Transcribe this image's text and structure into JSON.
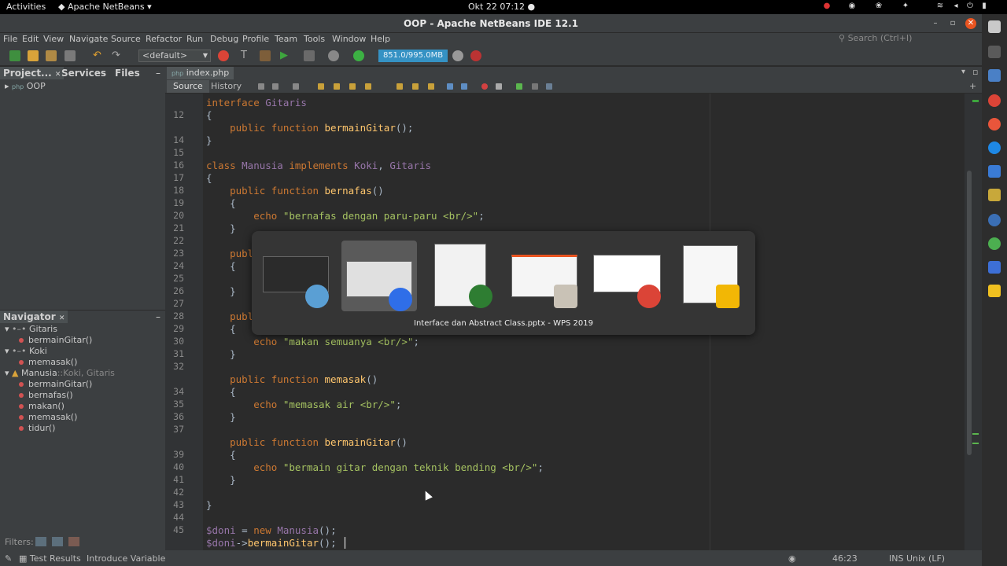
{
  "topbar": {
    "activities": "Activities",
    "app_menu": "Apache NetBeans",
    "clock": "Okt 22  07:12"
  },
  "window": {
    "title": "OOP - Apache NetBeans IDE 12.1"
  },
  "menu": [
    "File",
    "Edit",
    "View",
    "Navigate",
    "Source",
    "Refactor",
    "Run",
    "Debug",
    "Profile",
    "Team",
    "Tools",
    "Window",
    "Help"
  ],
  "search": {
    "placeholder": "Search (Ctrl+I)"
  },
  "toolbar": {
    "config": "<default>",
    "memory": "851.0/995.0MB"
  },
  "projects_panel": {
    "tabs": [
      "Project...",
      "Services",
      "Files"
    ],
    "root": "OOP"
  },
  "navigator": {
    "title": "Navigator",
    "items": [
      {
        "label": "Gitaris",
        "suffix": ""
      },
      {
        "label": "bermainGitar()",
        "suffix": ""
      },
      {
        "label": "Koki",
        "suffix": ""
      },
      {
        "label": "memasak()",
        "suffix": ""
      },
      {
        "label": "Manusia",
        "suffix": "::Koki, Gitaris"
      },
      {
        "label": "bermainGitar()",
        "suffix": ""
      },
      {
        "label": "bernafas()",
        "suffix": ""
      },
      {
        "label": "makan()",
        "suffix": ""
      },
      {
        "label": "memasak()",
        "suffix": ""
      },
      {
        "label": "tidur()",
        "suffix": ""
      }
    ],
    "filters_label": "Filters:"
  },
  "editor": {
    "file_tab": "index.php",
    "source_tab": "Source",
    "history_tab": "History",
    "line_numbers": [
      "",
      "12",
      "",
      "14",
      "15",
      "16",
      "17",
      "18",
      "19",
      "20",
      "21",
      "22",
      "23",
      "24",
      "25",
      "26",
      "27",
      "28",
      "29",
      "30",
      "31",
      "32",
      "",
      "34",
      "35",
      "36",
      "37",
      "",
      "39",
      "40",
      "41",
      "42",
      "43",
      "44",
      "45",
      ""
    ],
    "lines": [
      [
        "kw:interface ",
        "cls:Gitaris"
      ],
      [
        "t:{"
      ],
      [
        "t:    ",
        "kw:public function ",
        "fn:bermainGitar",
        "t:();"
      ],
      [
        "t:}"
      ],
      [
        "t:"
      ],
      [
        "kw:class ",
        "cls:Manusia ",
        "kw:implements ",
        "cls:Koki",
        "t:, ",
        "cls:Gitaris"
      ],
      [
        "t:{"
      ],
      [
        "t:    ",
        "kw:public function ",
        "fn:bernafas",
        "t:()"
      ],
      [
        "t:    {"
      ],
      [
        "t:        ",
        "kw:echo ",
        "str:\"bernafas dengan paru-paru <br/>\"",
        "t:;"
      ],
      [
        "t:    }"
      ],
      [
        "t:"
      ],
      [
        "t:    ",
        "kw:publ"
      ],
      [
        "t:    {"
      ],
      [
        "t:"
      ],
      [
        "t:    }"
      ],
      [
        "t:"
      ],
      [
        "t:    ",
        "kw:publ"
      ],
      [
        "t:    {"
      ],
      [
        "t:        ",
        "kw:echo ",
        "str:\"makan semuanya <br/>\"",
        "t:;"
      ],
      [
        "t:    }"
      ],
      [
        "t:"
      ],
      [
        "t:    ",
        "kw:public function ",
        "fn:memasak",
        "t:()"
      ],
      [
        "t:    {"
      ],
      [
        "t:        ",
        "kw:echo ",
        "str:\"memasak air <br/>\"",
        "t:;"
      ],
      [
        "t:    }"
      ],
      [
        "t:"
      ],
      [
        "t:    ",
        "kw:public function ",
        "fn:bermainGitar",
        "t:()"
      ],
      [
        "t:    {"
      ],
      [
        "t:        ",
        "kw:echo ",
        "str:\"bermain gitar dengan teknik bending <br/>\"",
        "t:;"
      ],
      [
        "t:    }"
      ],
      [
        "t:"
      ],
      [
        "t:}"
      ],
      [
        "t:"
      ],
      [
        "var:$doni",
        "t: = ",
        "kw:new ",
        "cls:Manusia",
        "t:();"
      ],
      [
        "var:$doni",
        "t:->",
        "fn:bermainGitar",
        "t:();"
      ]
    ]
  },
  "switcher": {
    "selected_label": "Interface dan Abstract Class.pptx - WPS 2019"
  },
  "status": {
    "test_results": "Test Results",
    "hint": "Introduce Variable",
    "position": "46:23",
    "mode": "INS Unix (LF)"
  }
}
